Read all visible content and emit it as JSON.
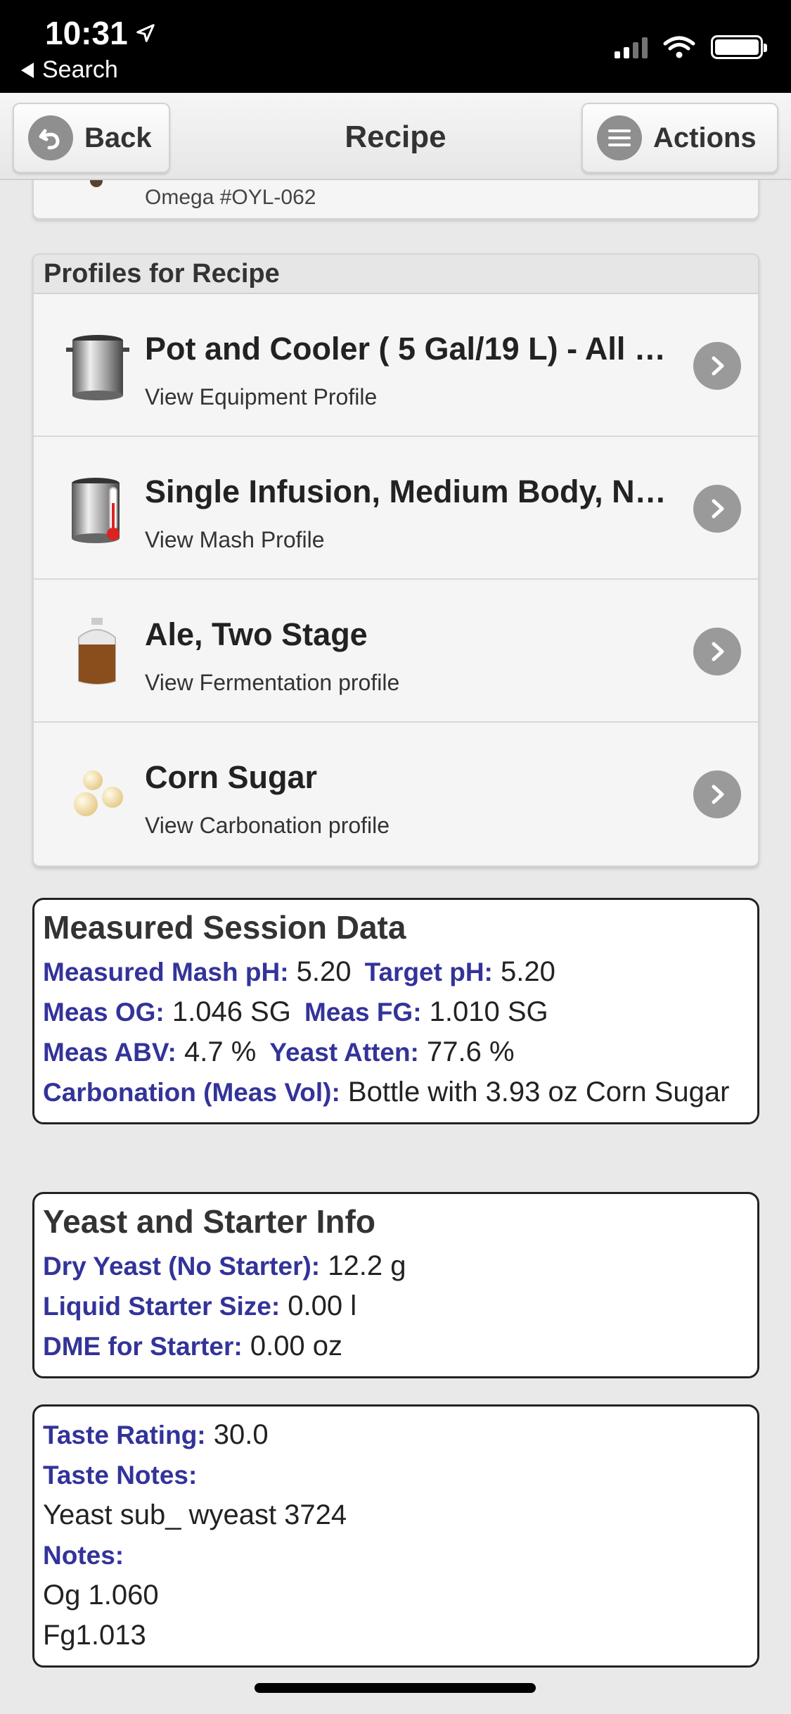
{
  "status_bar": {
    "time": "10:31",
    "back_label": "Search"
  },
  "header": {
    "back_label": "Back",
    "title": "Recipe",
    "actions_label": "Actions"
  },
  "prev_card": {
    "text": "Omega #OYL-062"
  },
  "profiles": {
    "heading": "Profiles for Recipe",
    "items": [
      {
        "title": "Pot and Cooler ( 5 Gal/19 L) - All …",
        "subtitle": "View Equipment Profile",
        "icon": "pot-icon"
      },
      {
        "title": "Single Infusion, Medium Body, N…",
        "subtitle": "View Mash Profile",
        "icon": "mash-tun-icon"
      },
      {
        "title": "Ale, Two Stage",
        "subtitle": "View Fermentation profile",
        "icon": "fermenter-icon"
      },
      {
        "title": "Corn Sugar",
        "subtitle": "View Carbonation profile",
        "icon": "sugar-icon"
      }
    ]
  },
  "measured": {
    "heading": "Measured Session Data",
    "mash_ph_label": "Measured Mash pH:",
    "mash_ph": "5.20",
    "target_ph_label": "Target pH:",
    "target_ph": "5.20",
    "og_label": "Meas OG:",
    "og": "1.046 SG",
    "fg_label": "Meas FG:",
    "fg": "1.010 SG",
    "abv_label": "Meas ABV:",
    "abv": "4.7 %",
    "atten_label": "Yeast Atten:",
    "atten": "77.6 %",
    "carb_label": "Carbonation (Meas Vol):",
    "carb": "Bottle with 3.93 oz Corn Sugar"
  },
  "yeast": {
    "heading": "Yeast and Starter Info",
    "dry_label": "Dry Yeast (No Starter):",
    "dry": "12.2 g",
    "starter_label": "Liquid Starter Size:",
    "starter": "0.00 l",
    "dme_label": "DME for Starter:",
    "dme": "0.00 oz"
  },
  "notes": {
    "rating_label": "Taste Rating:",
    "rating": "30.0",
    "taste_label": "Taste Notes:",
    "taste": "Yeast sub_ wyeast 3724",
    "notes_label": "Notes:",
    "notes_line1": "Og 1.060",
    "notes_line2": "Fg1.013"
  },
  "colors": {
    "label_blue": "#33339a",
    "chevron_gray": "#9a9a9a"
  }
}
